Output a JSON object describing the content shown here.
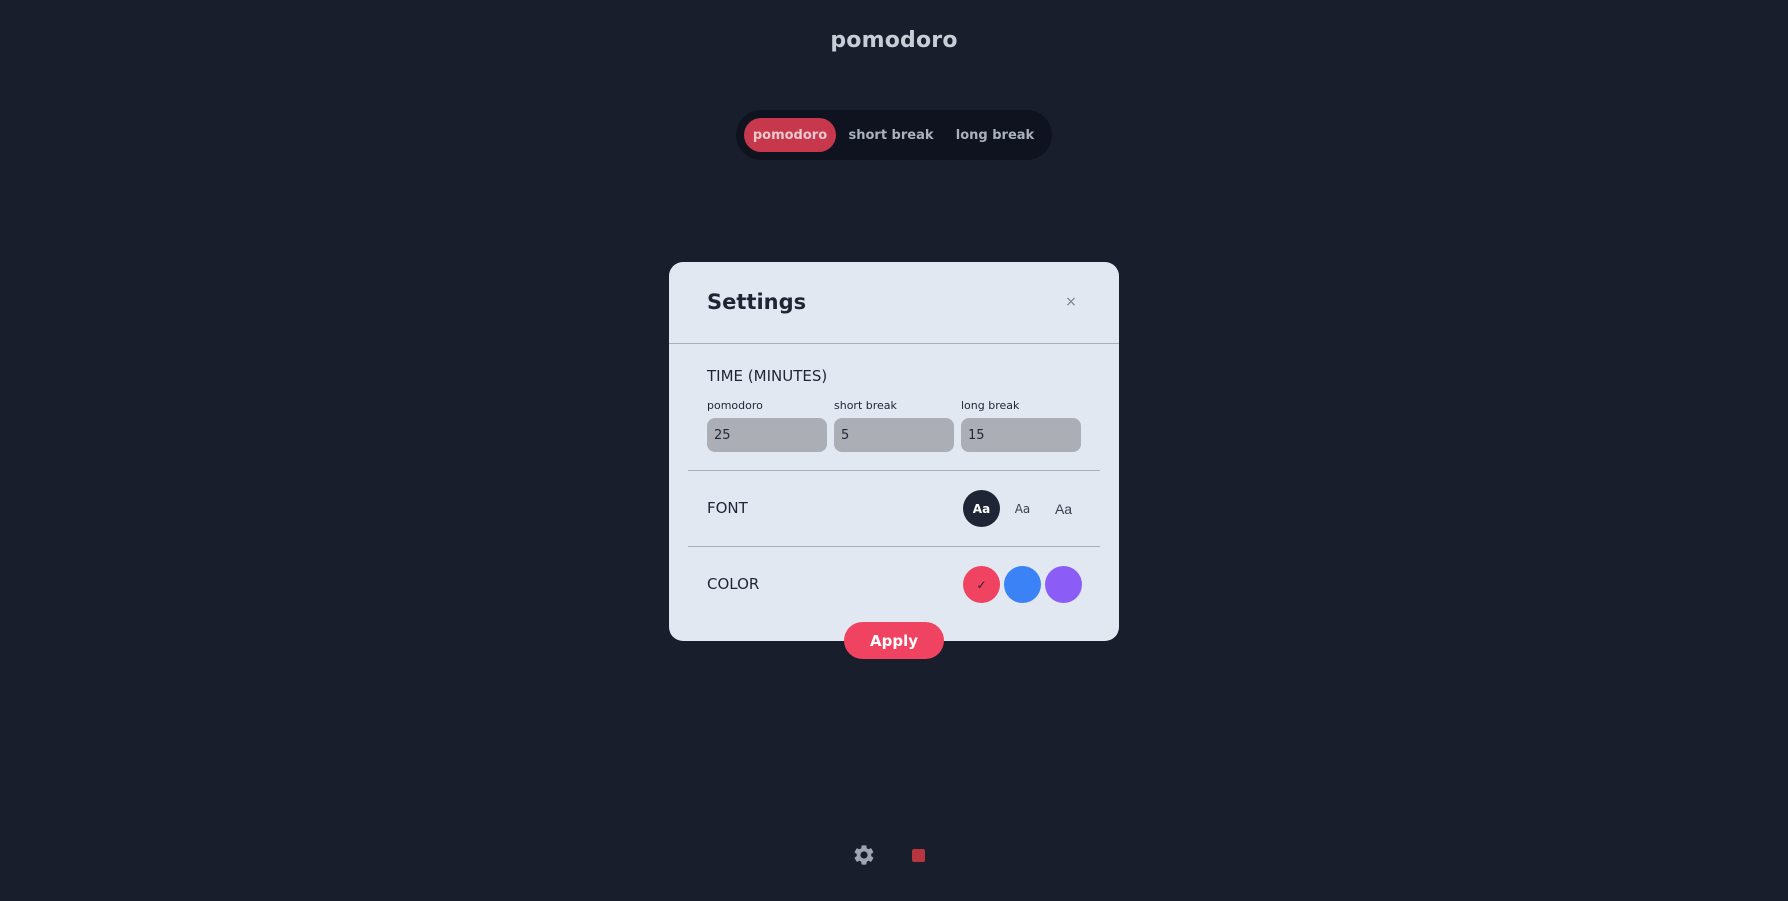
{
  "app": {
    "title": "pomodoro"
  },
  "modes": {
    "tabs": [
      {
        "label": "pomodoro",
        "active": true
      },
      {
        "label": "short break",
        "active": false
      },
      {
        "label": "long break",
        "active": false
      }
    ]
  },
  "settings": {
    "title": "Settings",
    "close_icon": "close-icon",
    "close_glyph": "×",
    "time": {
      "section_label": "TIME (MINUTES)",
      "fields": [
        {
          "label": "pomodoro",
          "value": "25"
        },
        {
          "label": "short break",
          "value": "5"
        },
        {
          "label": "long break",
          "value": "15"
        }
      ]
    },
    "font": {
      "section_label": "FONT",
      "options": [
        {
          "label": "Aa",
          "selected": true
        },
        {
          "label": "Aa",
          "selected": false
        },
        {
          "label": "Aa",
          "selected": false
        }
      ]
    },
    "color": {
      "section_label": "COLOR",
      "options": [
        {
          "color": "#f04361",
          "selected": true,
          "check_glyph": "✓"
        },
        {
          "color": "#3b82f6",
          "selected": false
        },
        {
          "color": "#8b5cf6",
          "selected": false
        }
      ]
    },
    "apply_label": "Apply"
  },
  "bottom": {
    "settings_icon": "gear-icon",
    "stop_icon": "stop-icon"
  },
  "colors": {
    "background": "#181e2b",
    "accent": "#f04361",
    "active_tab": "#c8384c",
    "card": "#e2e8f1"
  }
}
